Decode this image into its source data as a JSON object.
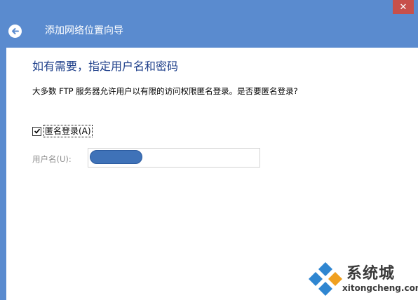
{
  "window": {
    "title": "添加网络位置向导",
    "close_label": "✕"
  },
  "page": {
    "heading": "如有需要，指定用户名和密码",
    "description": "大多数 FTP 服务器允许用户以有限的访问权限匿名登录。是否要匿名登录?"
  },
  "anonymous_login": {
    "label": "匿名登录(A)",
    "checked": true
  },
  "username": {
    "label": "用户名(U):",
    "value": ""
  },
  "watermark": {
    "title": "系统城",
    "url": "xitongcheng.com"
  },
  "colors": {
    "titlebar": "#5a8bcf",
    "heading": "#1e3f8a",
    "close": "#c7504b"
  }
}
